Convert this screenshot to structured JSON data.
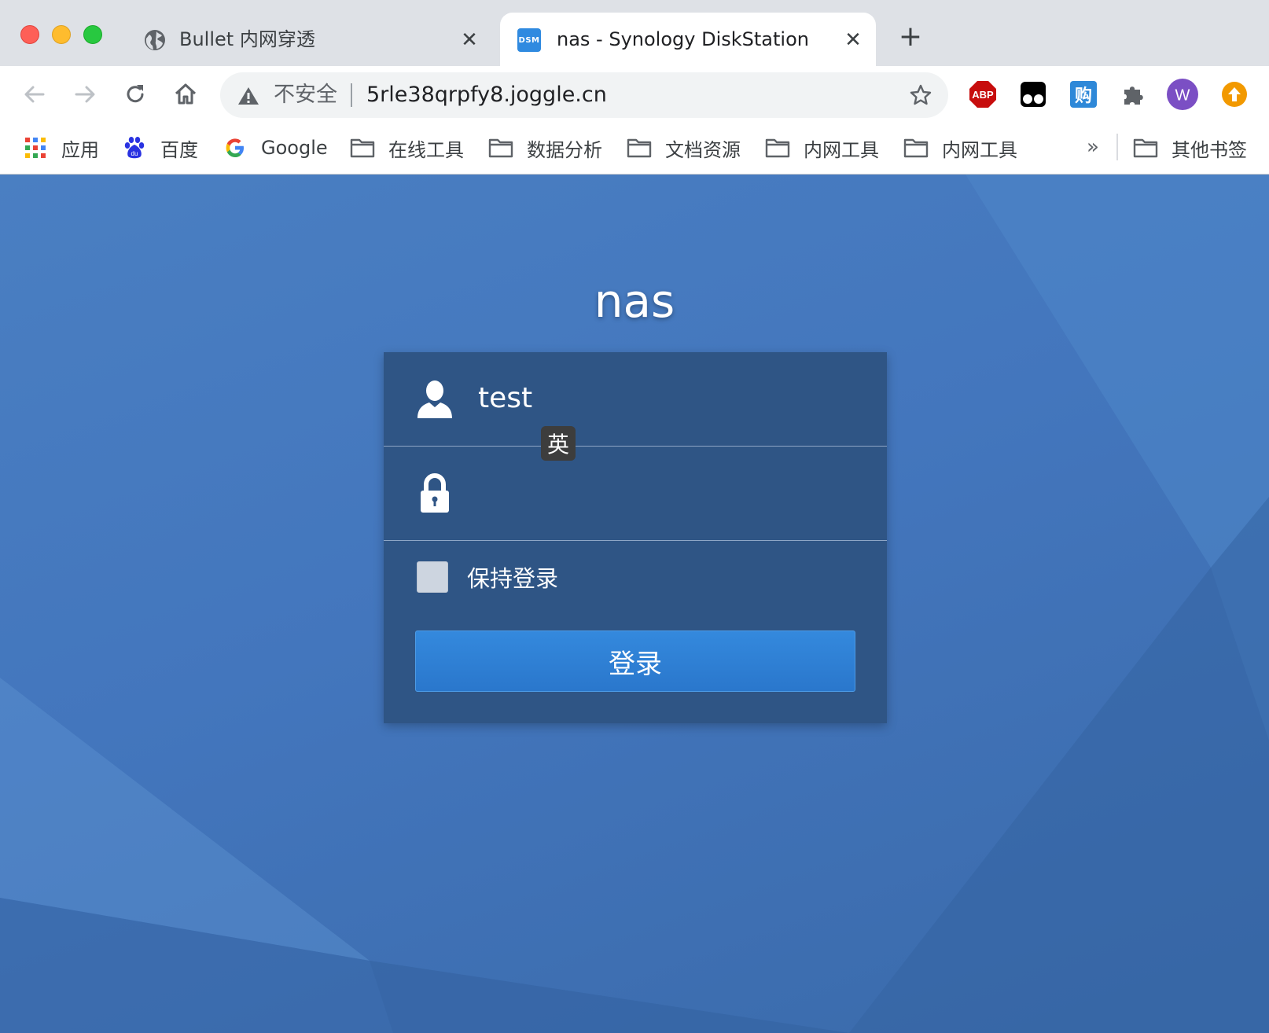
{
  "browser": {
    "tabs": [
      {
        "title": "Bullet 内网穿透",
        "icon": "globe-icon",
        "active": false
      },
      {
        "title": "nas - Synology DiskStation",
        "icon": "dsm-icon",
        "favicon_text": "DSM",
        "active": true
      }
    ],
    "omnibox": {
      "security_label": "不安全",
      "url": "5rle38qrpfy8.joggle.cn"
    },
    "profile_initial": "W",
    "bookmarks": [
      {
        "label": "应用",
        "icon": "apps-grid-icon"
      },
      {
        "label": "百度",
        "icon": "baidu-icon"
      },
      {
        "label": "Google",
        "icon": "google-icon"
      },
      {
        "label": "在线工具",
        "icon": "folder-icon"
      },
      {
        "label": "数据分析",
        "icon": "folder-icon"
      },
      {
        "label": "文档资源",
        "icon": "folder-icon"
      },
      {
        "label": "内网工具",
        "icon": "folder-icon"
      },
      {
        "label": "内网工具",
        "icon": "folder-icon"
      }
    ],
    "bookmarks_overflow": "»",
    "other_bookmarks": "其他书签",
    "extensions": [
      "abp-icon",
      "tampermonkey-icon",
      "gou-icon",
      "puzzle-icon"
    ],
    "extension_labels": {
      "abp": "ABP",
      "gou": "购"
    }
  },
  "login": {
    "server_name": "nas",
    "username": "test",
    "password": "",
    "ime_indicator": "英",
    "remember_label": "保持登录",
    "remember_checked": false,
    "submit_label": "登录"
  },
  "colors": {
    "page_bg": "#4376bd",
    "card_bg": "#2f5585",
    "button_bg": "#2f80d6"
  }
}
